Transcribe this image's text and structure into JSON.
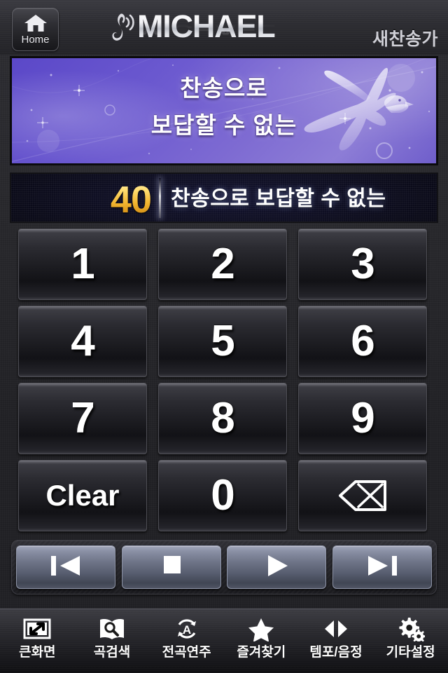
{
  "app": {
    "brand_name": "MICHAEL",
    "brand_icon": "treble-clef-sound-icon",
    "book_label": "새찬송가"
  },
  "header": {
    "home_label": "Home",
    "home_icon": "home-icon"
  },
  "banner": {
    "lyric_lines": "찬송으로\n보답할 수 없는",
    "art": "flying-dove-illustration",
    "background_colors": [
      "#5b48c8",
      "#8d7dd6"
    ]
  },
  "display": {
    "song_number": "40",
    "song_title": "찬송으로 보답할 수 없는",
    "number_color": "#f2b52f",
    "title_color": "#ffffff"
  },
  "keypad": {
    "keys": [
      {
        "label": "1",
        "name": "key-1",
        "type": "digit"
      },
      {
        "label": "2",
        "name": "key-2",
        "type": "digit"
      },
      {
        "label": "3",
        "name": "key-3",
        "type": "digit"
      },
      {
        "label": "4",
        "name": "key-4",
        "type": "digit"
      },
      {
        "label": "5",
        "name": "key-5",
        "type": "digit"
      },
      {
        "label": "6",
        "name": "key-6",
        "type": "digit"
      },
      {
        "label": "7",
        "name": "key-7",
        "type": "digit"
      },
      {
        "label": "8",
        "name": "key-8",
        "type": "digit"
      },
      {
        "label": "9",
        "name": "key-9",
        "type": "digit"
      },
      {
        "label": "Clear",
        "name": "key-clear",
        "type": "text"
      },
      {
        "label": "0",
        "name": "key-0",
        "type": "digit"
      },
      {
        "label": "",
        "name": "key-backspace",
        "type": "icon",
        "icon": "backspace-icon"
      }
    ]
  },
  "transport": {
    "buttons": [
      {
        "name": "previous-button",
        "icon": "skip-previous-icon",
        "label": ""
      },
      {
        "name": "stop-button",
        "icon": "stop-icon",
        "label": ""
      },
      {
        "name": "play-button",
        "icon": "play-icon",
        "label": ""
      },
      {
        "name": "next-button",
        "icon": "skip-next-icon",
        "label": ""
      }
    ]
  },
  "toolbar": {
    "items": [
      {
        "label": "큰화면",
        "icon": "fullscreen-expand-icon",
        "name": "toolbar-fullscreen"
      },
      {
        "label": "곡검색",
        "icon": "book-search-icon",
        "name": "toolbar-song-search"
      },
      {
        "label": "전곡연주",
        "icon": "play-all-loop-icon",
        "name": "toolbar-play-all"
      },
      {
        "label": "즐겨찾기",
        "icon": "star-icon",
        "name": "toolbar-favorites"
      },
      {
        "label": "템포/음정",
        "icon": "left-right-arrows-icon",
        "name": "toolbar-tempo-pitch"
      },
      {
        "label": "기타설정",
        "icon": "gears-icon",
        "name": "toolbar-settings"
      }
    ]
  }
}
